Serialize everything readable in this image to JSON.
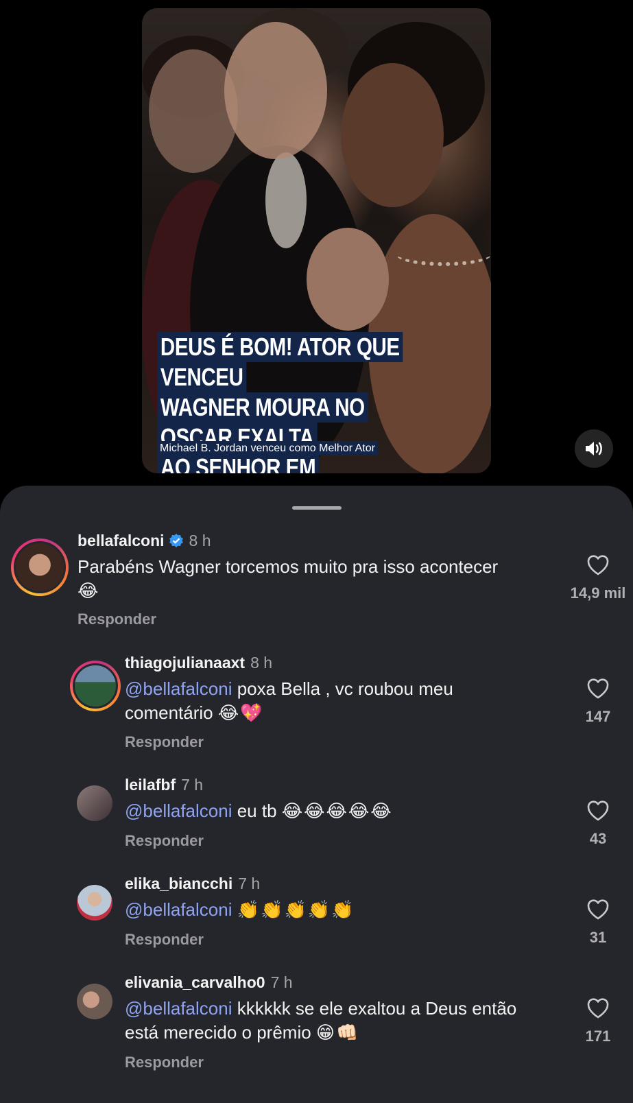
{
  "video": {
    "headline_lines": [
      "DEUS É BOM! ATOR QUE VENCEU",
      "WAGNER MOURA NO OSCAR EXALTA",
      "AO SENHOR EM DISCURSO"
    ],
    "caption": "Michael B. Jordan venceu como Melhor Ator",
    "sound_icon": "speaker-icon"
  },
  "comments": [
    {
      "username": "bellafalconi",
      "verified": true,
      "time": "8 h",
      "mention": "",
      "text": "Parabéns Wagner torcemos muito pra isso acontecer",
      "emoji": "😂",
      "likes": "14,9 mil",
      "reply": "Responder"
    },
    {
      "username": "thiagojulianaaxt",
      "verified": false,
      "time": "8 h",
      "mention": "@bellafalconi",
      "text": " poxa Bella , vc roubou meu comentário",
      "emoji": "😂💖",
      "likes": "147",
      "reply": "Responder"
    },
    {
      "username": "leilafbf",
      "verified": false,
      "time": "7 h",
      "mention": "@bellafalconi",
      "text": " eu tb",
      "emoji": "😂😂😂😂😂",
      "likes": "43",
      "reply": "Responder"
    },
    {
      "username": "elika_biancchi",
      "verified": false,
      "time": "7 h",
      "mention": "@bellafalconi",
      "text": "",
      "emoji": "👏👏👏👏👏",
      "likes": "31",
      "reply": "Responder"
    },
    {
      "username": "elivania_carvalho0",
      "verified": false,
      "time": "7 h",
      "mention": "@bellafalconi",
      "text": " kkkkkk se ele exaltou a Deus então está merecido o prêmio",
      "emoji": "😁👊🏻",
      "likes": "171",
      "reply": "Responder"
    }
  ],
  "colors": {
    "sheet_bg": "#25262b",
    "mention": "#8fa5f2",
    "verified_badge": "#3897f0",
    "headline_bg": "#14254a"
  }
}
